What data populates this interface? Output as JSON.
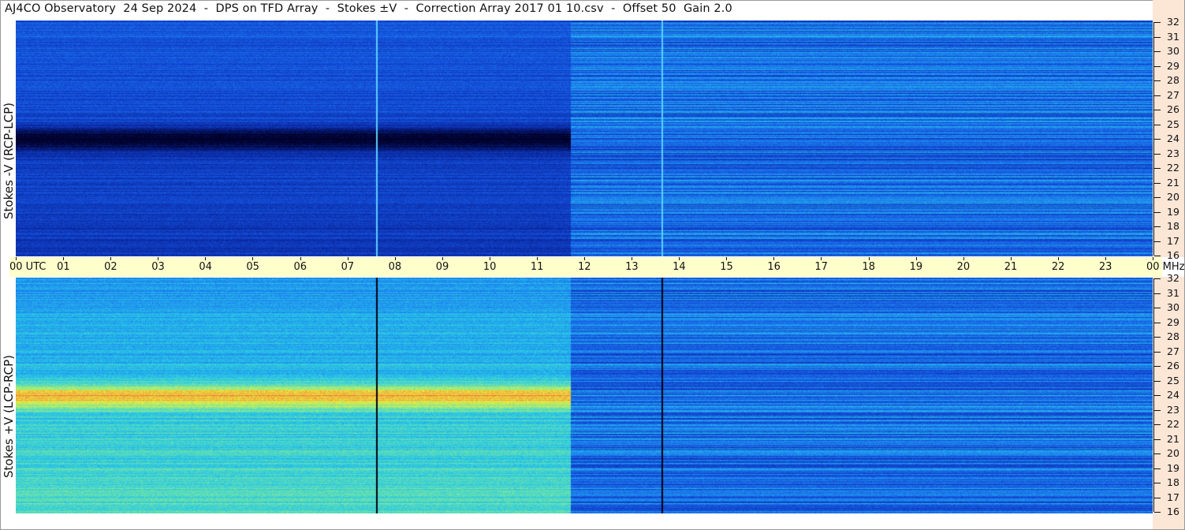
{
  "title": "AJ4CO Observatory  24 Sep 2024  -  DPS on TFD Array  -  Stokes ±V  -  Correction Array 2017 01 10.csv  -  Offset 50  Gain 2.0",
  "top_panel": {
    "ylabel": "Stokes -V (RCP-LCP)"
  },
  "bottom_panel": {
    "ylabel": "Stokes +V (LCP-RCP)"
  },
  "time_axis": {
    "labels": [
      "00",
      "01",
      "02",
      "03",
      "04",
      "05",
      "06",
      "07",
      "08",
      "09",
      "10",
      "11",
      "12",
      "13",
      "14",
      "15",
      "16",
      "17",
      "18",
      "19",
      "20",
      "21",
      "22",
      "23",
      "00"
    ],
    "start_suffix": "UTC",
    "end_suffix": "MHz"
  },
  "freq_axis": {
    "labels": [
      "32",
      "31",
      "30",
      "29",
      "28",
      "27",
      "26",
      "25",
      "24",
      "23",
      "22",
      "21",
      "20",
      "19",
      "18",
      "17",
      "16"
    ]
  },
  "colors": {
    "timebar": "#ffffcc",
    "freq_strip": "#fce6d6",
    "background_blue": "#1a55d6"
  }
}
